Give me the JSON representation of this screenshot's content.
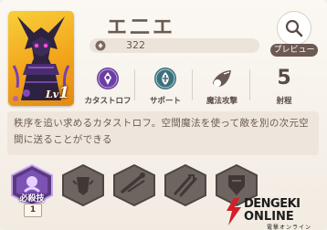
{
  "unit": {
    "name": "エ二エ",
    "level_prefix": "Lv",
    "level": "1",
    "cost": "322",
    "preview_label": "プレビュー"
  },
  "stats": [
    {
      "label": "カタストロフ",
      "icon": "catastrophe-icon"
    },
    {
      "label": "サポート",
      "icon": "support-icon"
    },
    {
      "label": "魔法攻撃",
      "icon": "magic-attack-icon"
    },
    {
      "label": "射程",
      "value": "5"
    }
  ],
  "description": "秩序を追い求めるカタストロフ。空間魔法を使って敵を別の次元空間に送ることができる",
  "skills": [
    {
      "label": "必殺技",
      "level": "1",
      "locked": false
    },
    {
      "locked": true
    },
    {
      "locked": true
    },
    {
      "locked": true
    },
    {
      "locked": true
    }
  ],
  "watermark": {
    "line1": "DENGEKI",
    "line2": "ONLINE",
    "sub": "電撃オンライン"
  },
  "colors": {
    "accent_purple": "#6b3fa0",
    "text_brown": "#6b5a52",
    "locked_gray": "#6e6561"
  }
}
